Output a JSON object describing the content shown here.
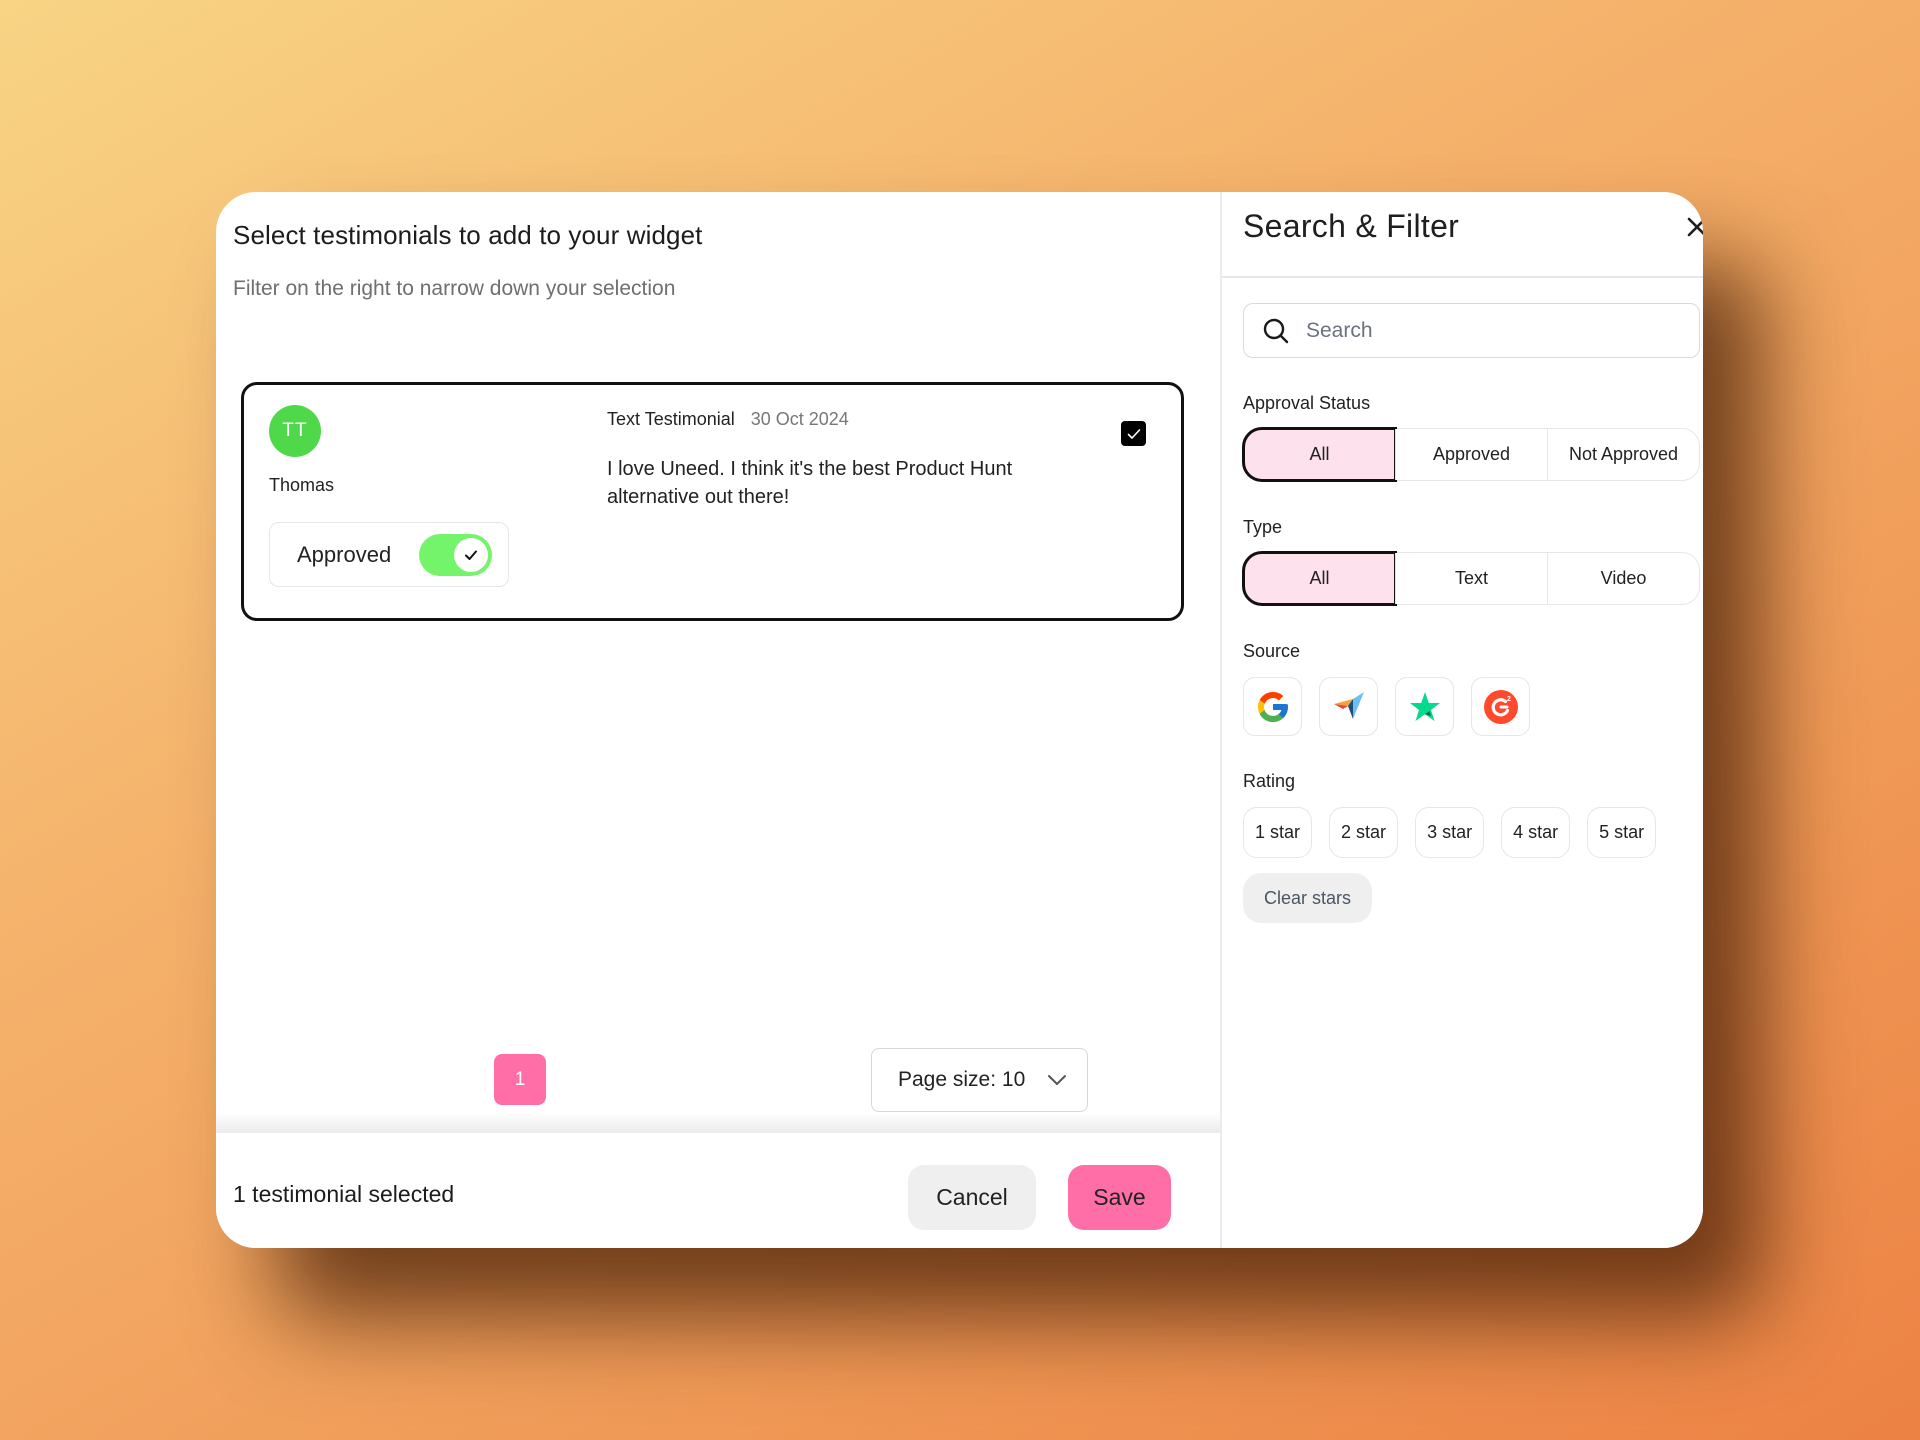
{
  "main": {
    "title": "Select testimonials to add to your widget",
    "subtitle": "Filter on the right to narrow down your selection",
    "testimonials": [
      {
        "initials": "TT",
        "avatar_color": "#4fd94a",
        "author": "Thomas",
        "approval_label": "Approved",
        "approved": true,
        "type": "Text Testimonial",
        "date": "30 Oct 2024",
        "text": "I love Uneed. I think it's the best Product Hunt alternative out there!",
        "selected": true
      }
    ],
    "pagination": {
      "current_page": "1",
      "page_size_label": "Page size: 10"
    },
    "footer": {
      "selected_count": "1 testimonial selected",
      "cancel_label": "Cancel",
      "save_label": "Save"
    }
  },
  "filter": {
    "title": "Search & Filter",
    "close_icon": "close-icon",
    "search": {
      "placeholder": "Search",
      "value": ""
    },
    "approval_status": {
      "label": "Approval Status",
      "options": [
        "All",
        "Approved",
        "Not Approved"
      ],
      "selected": "All"
    },
    "type": {
      "label": "Type",
      "options": [
        "All",
        "Text",
        "Video"
      ],
      "selected": "All"
    },
    "source": {
      "label": "Source",
      "options": [
        "google-icon",
        "capterra-icon",
        "trustpilot-icon",
        "g2-icon"
      ]
    },
    "rating": {
      "label": "Rating",
      "options": [
        "1 star",
        "2 star",
        "3 star",
        "4 star",
        "5 star"
      ],
      "clear_label": "Clear stars"
    }
  },
  "colors": {
    "accent_pink": "#ff6ea6",
    "active_segment": "#fde1ec",
    "toggle_on": "#74f46a"
  }
}
